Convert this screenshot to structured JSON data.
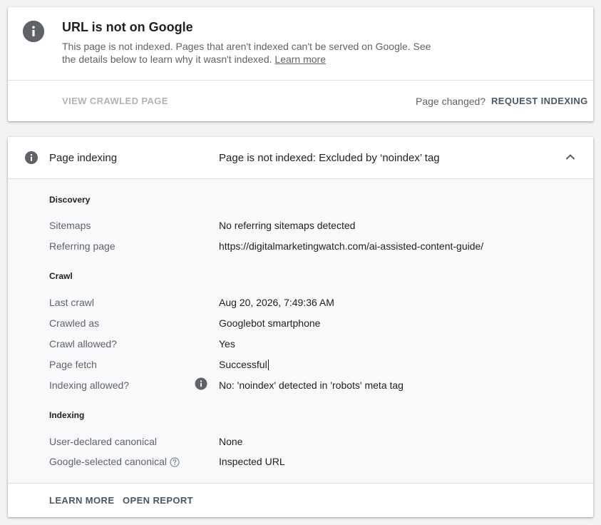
{
  "status": {
    "title": "URL is not on Google",
    "description": "This page is not indexed. Pages that aren't indexed can't be served on Google. See the details below to learn why it wasn't indexed.",
    "learn_more_link": "Learn more",
    "view_crawled_label": "VIEW CRAWLED PAGE",
    "page_changed_label": "Page changed?",
    "request_indexing_label": "REQUEST INDEXING",
    "icon": "info-icon"
  },
  "details": {
    "header": {
      "label": "Page indexing",
      "value": "Page is not indexed: Excluded by ‘noindex’ tag",
      "icon": "info-icon",
      "toggle_icon": "chevron-up-icon"
    },
    "sections": {
      "discovery": {
        "title": "Discovery",
        "sitemaps_label": "Sitemaps",
        "sitemaps_value": "No referring sitemaps detected",
        "referring_label": "Referring page",
        "referring_value": "https://digitalmarketingwatch.com/ai-assisted-content-guide/"
      },
      "crawl": {
        "title": "Crawl",
        "last_crawl_label": "Last crawl",
        "last_crawl_value": "Aug 20, 2026, 7:49:36 AM",
        "crawled_as_label": "Crawled as",
        "crawled_as_value": "Googlebot smartphone",
        "crawl_allowed_label": "Crawl allowed?",
        "crawl_allowed_value": "Yes",
        "page_fetch_label": "Page fetch",
        "page_fetch_value": "Successful",
        "indexing_allowed_label": "Indexing allowed?",
        "indexing_allowed_value": "No: 'noindex' detected in 'robots' meta tag"
      },
      "indexing": {
        "title": "Indexing",
        "user_canonical_label": "User-declared canonical",
        "user_canonical_value": "None",
        "google_canonical_label": "Google-selected canonical",
        "google_canonical_value": "Inspected URL"
      }
    },
    "footer": {
      "learn_more_label": "LEARN MORE",
      "open_report_label": "OPEN REPORT"
    }
  },
  "colors": {
    "background": "#f1f3f4",
    "card": "#ffffff",
    "details_body": "#f8f9fa",
    "icon_gray": "#5f6368",
    "action": "#455a64",
    "disabled": "#b0b3b6"
  }
}
